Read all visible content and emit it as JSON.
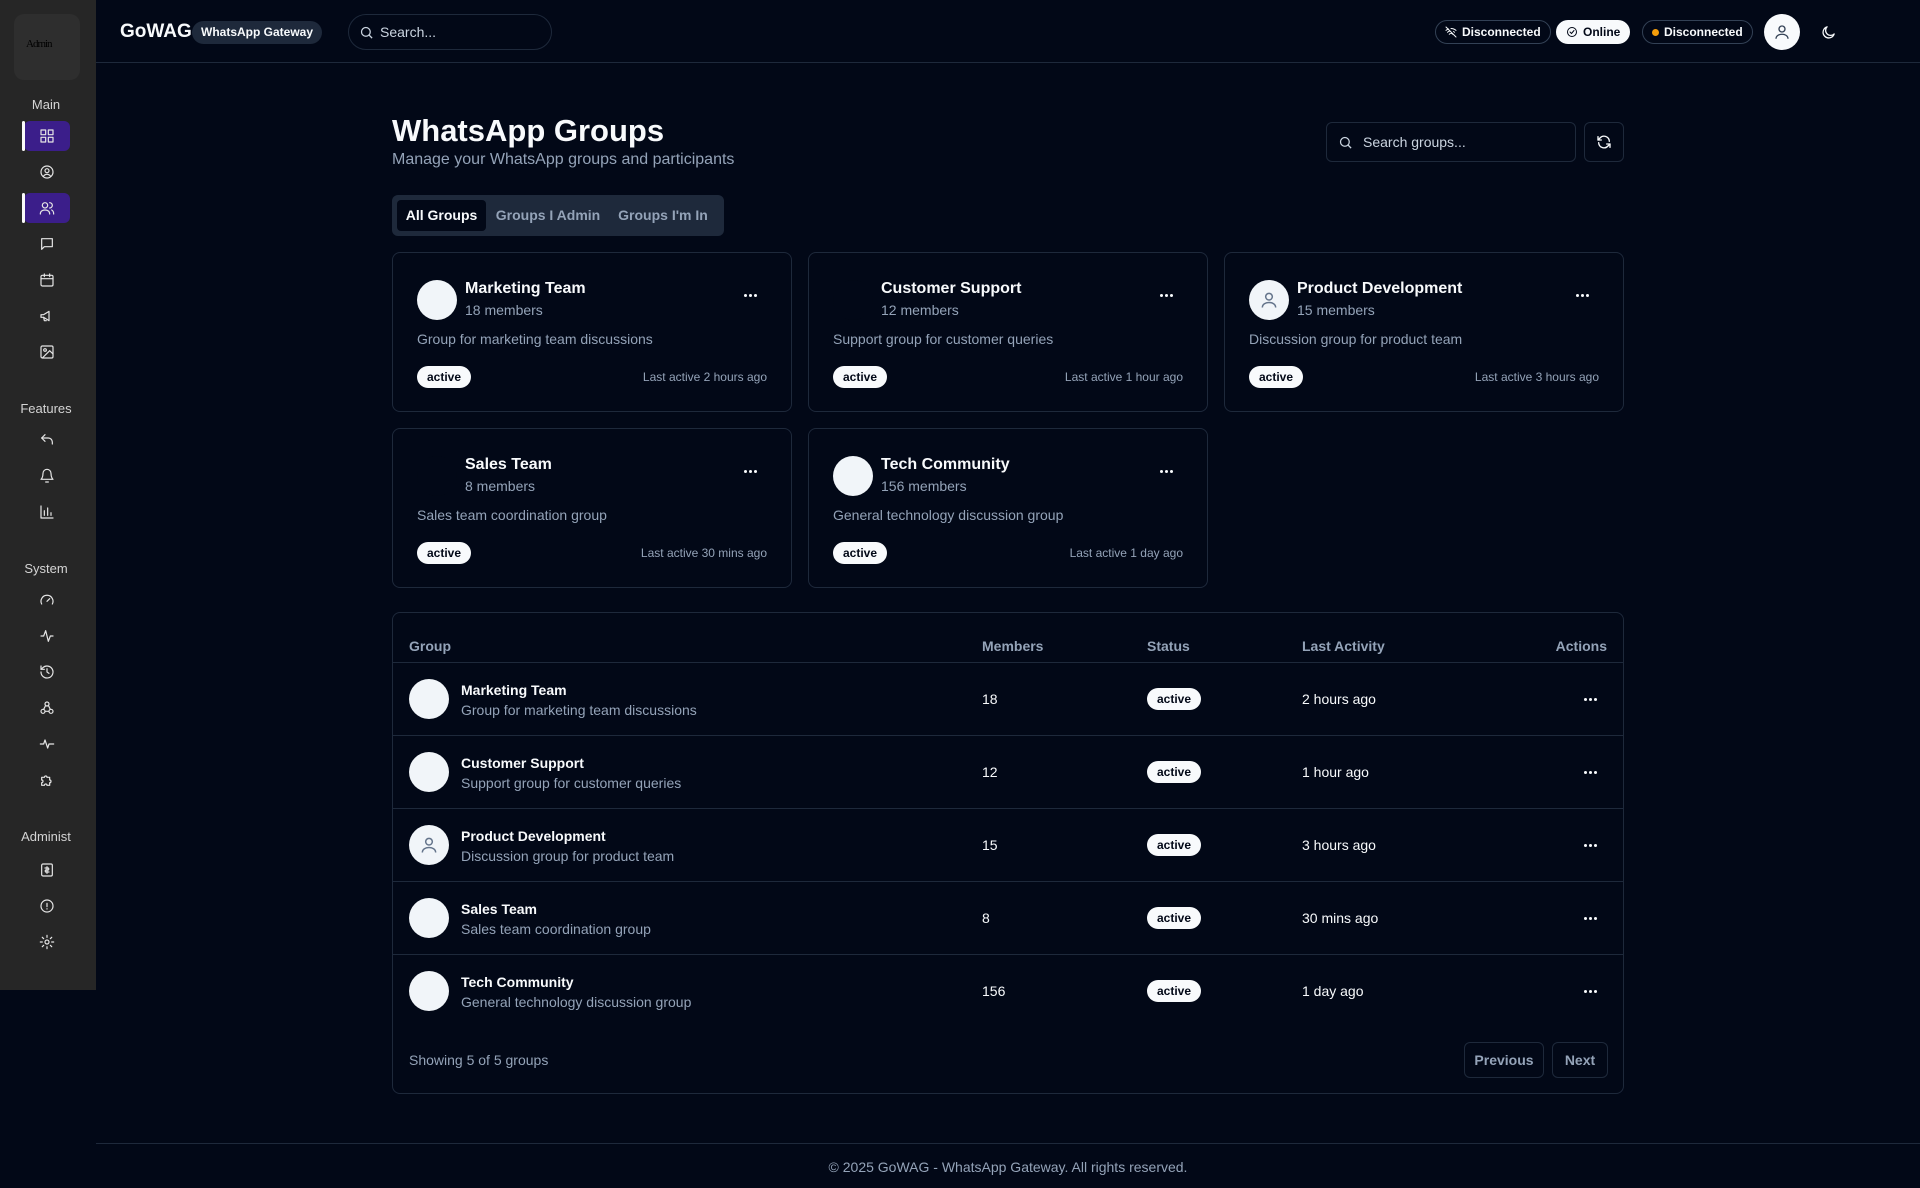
{
  "header": {
    "brand": "GoWAG",
    "brand_badge": "WhatsApp Gateway",
    "search_placeholder": "Search...",
    "status": [
      {
        "label": "Disconnected",
        "icon": "wifi-off-icon"
      },
      {
        "label": "Online",
        "icon": "check-circle-icon"
      },
      {
        "label": "Disconnected",
        "icon": "status-dot",
        "color": "#f59e0b"
      }
    ]
  },
  "sidebar": {
    "logo_text": "Admin",
    "sections": [
      "Main",
      "Features",
      "System",
      "Administ"
    ],
    "main_items": [
      "dashboard-icon",
      "user-circle-icon",
      "users-icon",
      "message-icon",
      "calendar-icon",
      "megaphone-icon",
      "image-icon"
    ],
    "feature_items": [
      "reply-icon",
      "bell-ring-icon",
      "bar-chart-icon"
    ],
    "system_items": [
      "gauge-icon",
      "activity-icon",
      "history-icon",
      "webhook-icon",
      "pulse-icon",
      "puzzle-icon"
    ],
    "admin_items": [
      "receipt-icon",
      "info-icon",
      "settings-icon"
    ]
  },
  "page": {
    "title": "WhatsApp Groups",
    "subtitle": "Manage your WhatsApp groups and participants",
    "search_placeholder": "Search groups...",
    "tabs": [
      "All Groups",
      "Groups I Admin",
      "Groups I'm In"
    ]
  },
  "groups": [
    {
      "name": "Marketing Team",
      "members": "18 members",
      "member_count": "18",
      "description": "Group for marketing team discussions",
      "status": "active",
      "last_active": "Last active 2 hours ago",
      "last_activity": "2 hours ago"
    },
    {
      "name": "Customer Support",
      "members": "12 members",
      "member_count": "12",
      "description": "Support group for customer queries",
      "status": "active",
      "last_active": "Last active 1 hour ago",
      "last_activity": "1 hour ago"
    },
    {
      "name": "Product Development",
      "members": "15 members",
      "member_count": "15",
      "description": "Discussion group for product team",
      "status": "active",
      "last_active": "Last active 3 hours ago",
      "last_activity": "3 hours ago"
    },
    {
      "name": "Sales Team",
      "members": "8 members",
      "member_count": "8",
      "description": "Sales team coordination group",
      "status": "active",
      "last_active": "Last active 30 mins ago",
      "last_activity": "30 mins ago"
    },
    {
      "name": "Tech Community",
      "members": "156 members",
      "member_count": "156",
      "description": "General technology discussion group",
      "status": "active",
      "last_active": "Last active 1 day ago",
      "last_activity": "1 day ago"
    }
  ],
  "table": {
    "columns": [
      "Group",
      "Members",
      "Status",
      "Last Activity",
      "Actions"
    ],
    "showing": "Showing 5 of 5 groups",
    "prev": "Previous",
    "next": "Next"
  },
  "footer": "© 2025 GoWAG - WhatsApp Gateway. All rights reserved.",
  "colors": {
    "background": "#020817",
    "sidebar": "#262626",
    "accent": "#3b1e8a",
    "warning": "#f59e0b"
  }
}
